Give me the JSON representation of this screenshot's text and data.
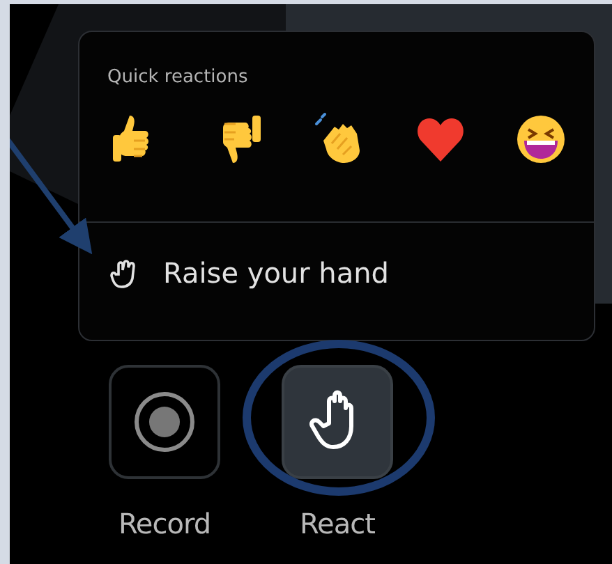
{
  "reactions_menu": {
    "title": "Quick reactions",
    "reactions": [
      {
        "kind": "thumbs-up"
      },
      {
        "kind": "thumbs-down"
      },
      {
        "kind": "clap"
      },
      {
        "kind": "heart"
      },
      {
        "kind": "laugh"
      }
    ],
    "raise_hand": {
      "label": "Raise your hand"
    }
  },
  "buttons": [
    {
      "label": "Record",
      "kind": "record",
      "selected": false
    },
    {
      "label": "React",
      "kind": "react",
      "selected": true
    }
  ]
}
